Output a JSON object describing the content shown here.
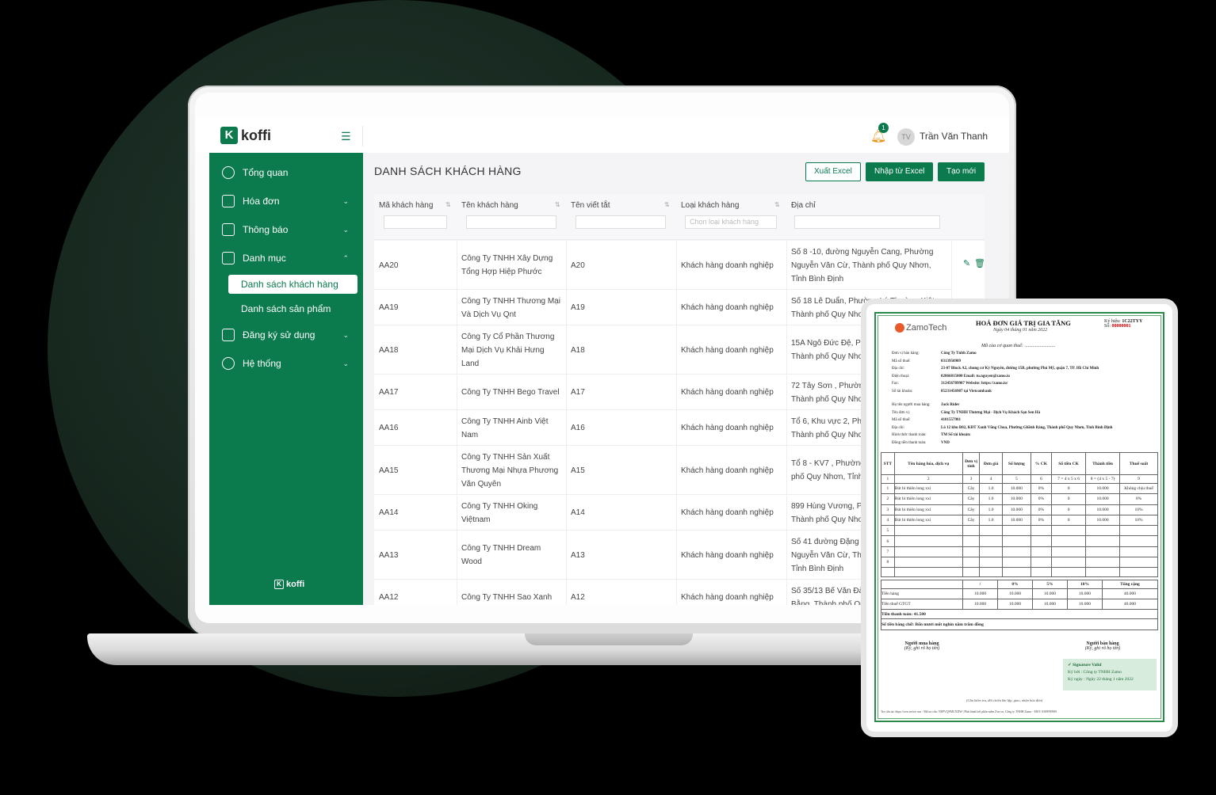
{
  "app": {
    "brand": "koffi",
    "brand_mark": "K",
    "user_initials": "TV",
    "user_name": "Trần Văn Thanh",
    "notification_count": "1"
  },
  "sidebar": {
    "items": [
      {
        "label": "Tổng quan",
        "icon": "dashboard-icon"
      },
      {
        "label": "Hóa đơn",
        "icon": "invoice-icon"
      },
      {
        "label": "Thông báo",
        "icon": "notice-icon"
      },
      {
        "label": "Danh mục",
        "icon": "category-icon"
      },
      {
        "label": "Đăng ký sử dụng",
        "icon": "register-icon"
      },
      {
        "label": "Hệ thống",
        "icon": "settings-icon"
      }
    ],
    "sub_items": [
      "Danh sách khách hàng",
      "Danh sách sản phẩm"
    ],
    "footer": "koffi"
  },
  "page": {
    "title": "DANH SÁCH KHÁCH HÀNG",
    "buttons": {
      "export": "Xuất Excel",
      "import": "Nhập từ Excel",
      "create": "Tạo mới"
    }
  },
  "table": {
    "headers": [
      "Mã khách hàng",
      "Tên khách hàng",
      "Tên viết tắt",
      "Loại khách hàng",
      "Địa chỉ"
    ],
    "filter_placeholder": "Chọn loại khách hàng",
    "rows": [
      {
        "code": "AA20",
        "name": [
          "Công Ty TNHH Xây Dựng",
          "Tổng Hợp Hiệp Phước"
        ],
        "abbr": "A20",
        "type": "Khách hàng doanh nghiệp",
        "addr": [
          "Số 8 -10, đường Nguyễn Cang, Phường",
          "Nguyễn Văn Cừ, Thành phố Quy Nhơn,",
          "Tỉnh Bình Định"
        ]
      },
      {
        "code": "AA19",
        "name": [
          "Công Ty TNHH Thương Mại",
          "Và Dịch Vụ Qnt"
        ],
        "abbr": "A19",
        "type": "Khách hàng doanh nghiệp",
        "addr": [
          "Số 18 Lê Duẩn, Phường Lý Thường Kiệt,",
          "Thành phố Quy Nhơn"
        ]
      },
      {
        "code": "AA18",
        "name": [
          "Công Ty Cổ Phần Thương",
          "Mại Dịch Vụ Khải Hưng",
          "Land"
        ],
        "abbr": "A18",
        "type": "Khách hàng doanh nghiệp",
        "addr": [
          "15A Ngô Đức Đệ, Ph",
          "Thành phố Quy Nhơn"
        ]
      },
      {
        "code": "AA17",
        "name": [
          "Công Ty TNHH Bego Travel"
        ],
        "abbr": "A17",
        "type": "Khách hàng doanh nghiệp",
        "addr": [
          "72 Tây Sơn , Phường",
          "Thành phố Quy Nhơn"
        ]
      },
      {
        "code": "AA16",
        "name": [
          "Công Ty TNHH Ainb Việt",
          "Nam"
        ],
        "abbr": "A16",
        "type": "Khách hàng doanh nghiệp",
        "addr": [
          "Tổ 6, Khu vực 2, Ph",
          "Thành phố Quy Nhơn"
        ]
      },
      {
        "code": "AA15",
        "name": [
          "Công Ty TNHH Sản Xuất",
          "Thương Mại Nhựa Phương",
          "Văn Quyên"
        ],
        "abbr": "A15",
        "type": "Khách hàng doanh nghiệp",
        "addr": [
          "Tổ 8 - KV7 , Phường",
          "phố Quy Nhơn, Tỉnh I"
        ]
      },
      {
        "code": "AA14",
        "name": [
          "Công Ty TNHH Oking",
          "Việtnam"
        ],
        "abbr": "A14",
        "type": "Khách hàng doanh nghiệp",
        "addr": [
          "899 Hùng Vương, Ph",
          "Thành phố Quy Nhơn"
        ]
      },
      {
        "code": "AA13",
        "name": [
          "Công Ty TNHH Dream",
          "Wood"
        ],
        "abbr": "A13",
        "type": "Khách hàng doanh nghiệp",
        "addr": [
          "Số 41 đường Đặng V",
          "Nguyễn Văn Cừ, Thà",
          "Tỉnh Bình Định"
        ]
      },
      {
        "code": "AA12",
        "name": [
          "Công Ty TNHH Sao Xanh"
        ],
        "abbr": "A12",
        "type": "Khách hàng doanh nghiệp",
        "addr": [
          "Số 35/13 Bế Văn Đàn",
          "Bằng, Thành phố Qu"
        ]
      }
    ]
  },
  "invoice": {
    "brand": "ZamoTech",
    "title": "HOÁ ĐƠN GIÁ TRỊ GIA TĂNG",
    "date": "Ngày 04 tháng 01 năm 2022",
    "symbol_label": "Ký hiệu:",
    "symbol": "1C22TYY",
    "number_label": "Số:",
    "number": "00000001",
    "tax_code_line": "Mã của cơ quan thuế: ..........................",
    "seller": [
      [
        "Đơn vị bán hàng:",
        "Công Ty Tnhh Zamo"
      ],
      [
        "Mã số thuế:",
        "0313950909"
      ],
      [
        "Địa chỉ:",
        "23-07 Block A2, chung cư Kỳ Nguyên, đường 15B, phường Phú Mỹ, quận 7, TP. Hồ Chí Minh"
      ],
      [
        "Điện thoại:",
        "02866815000     Email:       tu.nguyen@zamo.io"
      ],
      [
        "Fax:",
        "312456789987     Website:     https://zamo.io/"
      ],
      [
        "Số tài khoản:",
        "85231456987 tại Vietcombank"
      ]
    ],
    "buyer": [
      [
        "Họ tên người mua hàng:",
        "Jack Rider"
      ],
      [
        "Tên đơn vị:",
        "Công Ty TNHH Thương Mại - Dịch Vụ Khách Sạn Sen Hà"
      ],
      [
        "Mã số thuế:",
        "4101557901"
      ],
      [
        "Địa chỉ:",
        "Lô 12 khu B02, KĐT Xanh Vũng Chua, Phường Ghềnh Ráng, Thành phố Quy Nhơn, Tỉnh Bình Định"
      ],
      [
        "Hình thức thanh toán:",
        "TM                 Số tài khoản:"
      ],
      [
        "Đồng tiền thanh toán:",
        "VND"
      ]
    ],
    "item_headers": [
      "STT",
      "Tên hàng hóa, dịch vụ",
      "Đơn vị tính",
      "Đơn giá",
      "Số lượng",
      "% CK",
      "Số tiền CK",
      "Thành tiền",
      "Thuế suất"
    ],
    "item_index_row": [
      "1",
      "2",
      "3",
      "4",
      "5",
      "6",
      "7 = 4 x 5 x 6",
      "8 = (4 x 5 - 7)",
      "9"
    ],
    "items": [
      [
        "1",
        "Bút bi thiên long xxi",
        "Cây",
        "1.0",
        "10.000",
        "0%",
        "0",
        "10.000",
        "Không chịu thuế"
      ],
      [
        "2",
        "Bút bi thiên long xxi",
        "Cây",
        "1.0",
        "10.000",
        "0%",
        "0",
        "10.000",
        "0%"
      ],
      [
        "3",
        "Bút bi thiên long xxi",
        "Cây",
        "1.0",
        "10.000",
        "0%",
        "0",
        "10.000",
        "10%"
      ],
      [
        "4",
        "Bút bi thiên long xxi",
        "Cây",
        "1.0",
        "10.000",
        "0%",
        "0",
        "10.000",
        "10%"
      ],
      [
        "5",
        "",
        "",
        "",
        "",
        "",
        "",
        "",
        ""
      ],
      [
        "6",
        "",
        "",
        "",
        "",
        "",
        "",
        "",
        ""
      ],
      [
        "7",
        "",
        "",
        "",
        "",
        "",
        "",
        "",
        ""
      ],
      [
        "8",
        "",
        "",
        "",
        "",
        "",
        "",
        "",
        ""
      ]
    ],
    "summary_headers": [
      "",
      "/",
      "0%",
      "5%",
      "10%",
      "Tổng cộng"
    ],
    "summary_rows": [
      [
        "Tiền hàng",
        "10.000",
        "10.000",
        "10.000",
        "10.000",
        "40.000"
      ],
      [
        "Tiền thuế GTGT",
        "10.000",
        "10.000",
        "10.000",
        "10.000",
        "40.000"
      ]
    ],
    "total_label": "Tiền thanh toán:",
    "total_value": "41.500",
    "words_label": "Số tiền bằng chữ:",
    "words_value": "Bốn mươi mốt nghìn năm trăm đồng",
    "buyer_sign": "Người mua hàng",
    "seller_sign": "Người bán hàng",
    "sign_hint": "(Ký, ghi rõ họ tên)",
    "valid_title": "Signature Valid",
    "valid_by": "Ký bởi : Công ty TNHH Zamo",
    "valid_date": "Ký ngày : Ngày 22 tháng 1  năm 2022",
    "check_note": "(Cần kiểm tra, đối chiếu khi lập, giao, nhận hóa đơn)",
    "footer_note": "Tra cứu tại: https://zvn.vn/tra-cuu - Mã tra cứu: NEPVQFMUXDW | Phát hành bởi phần mềm Zvn.vn, Công ty TNHH Zamo - MST: 0309950909"
  }
}
